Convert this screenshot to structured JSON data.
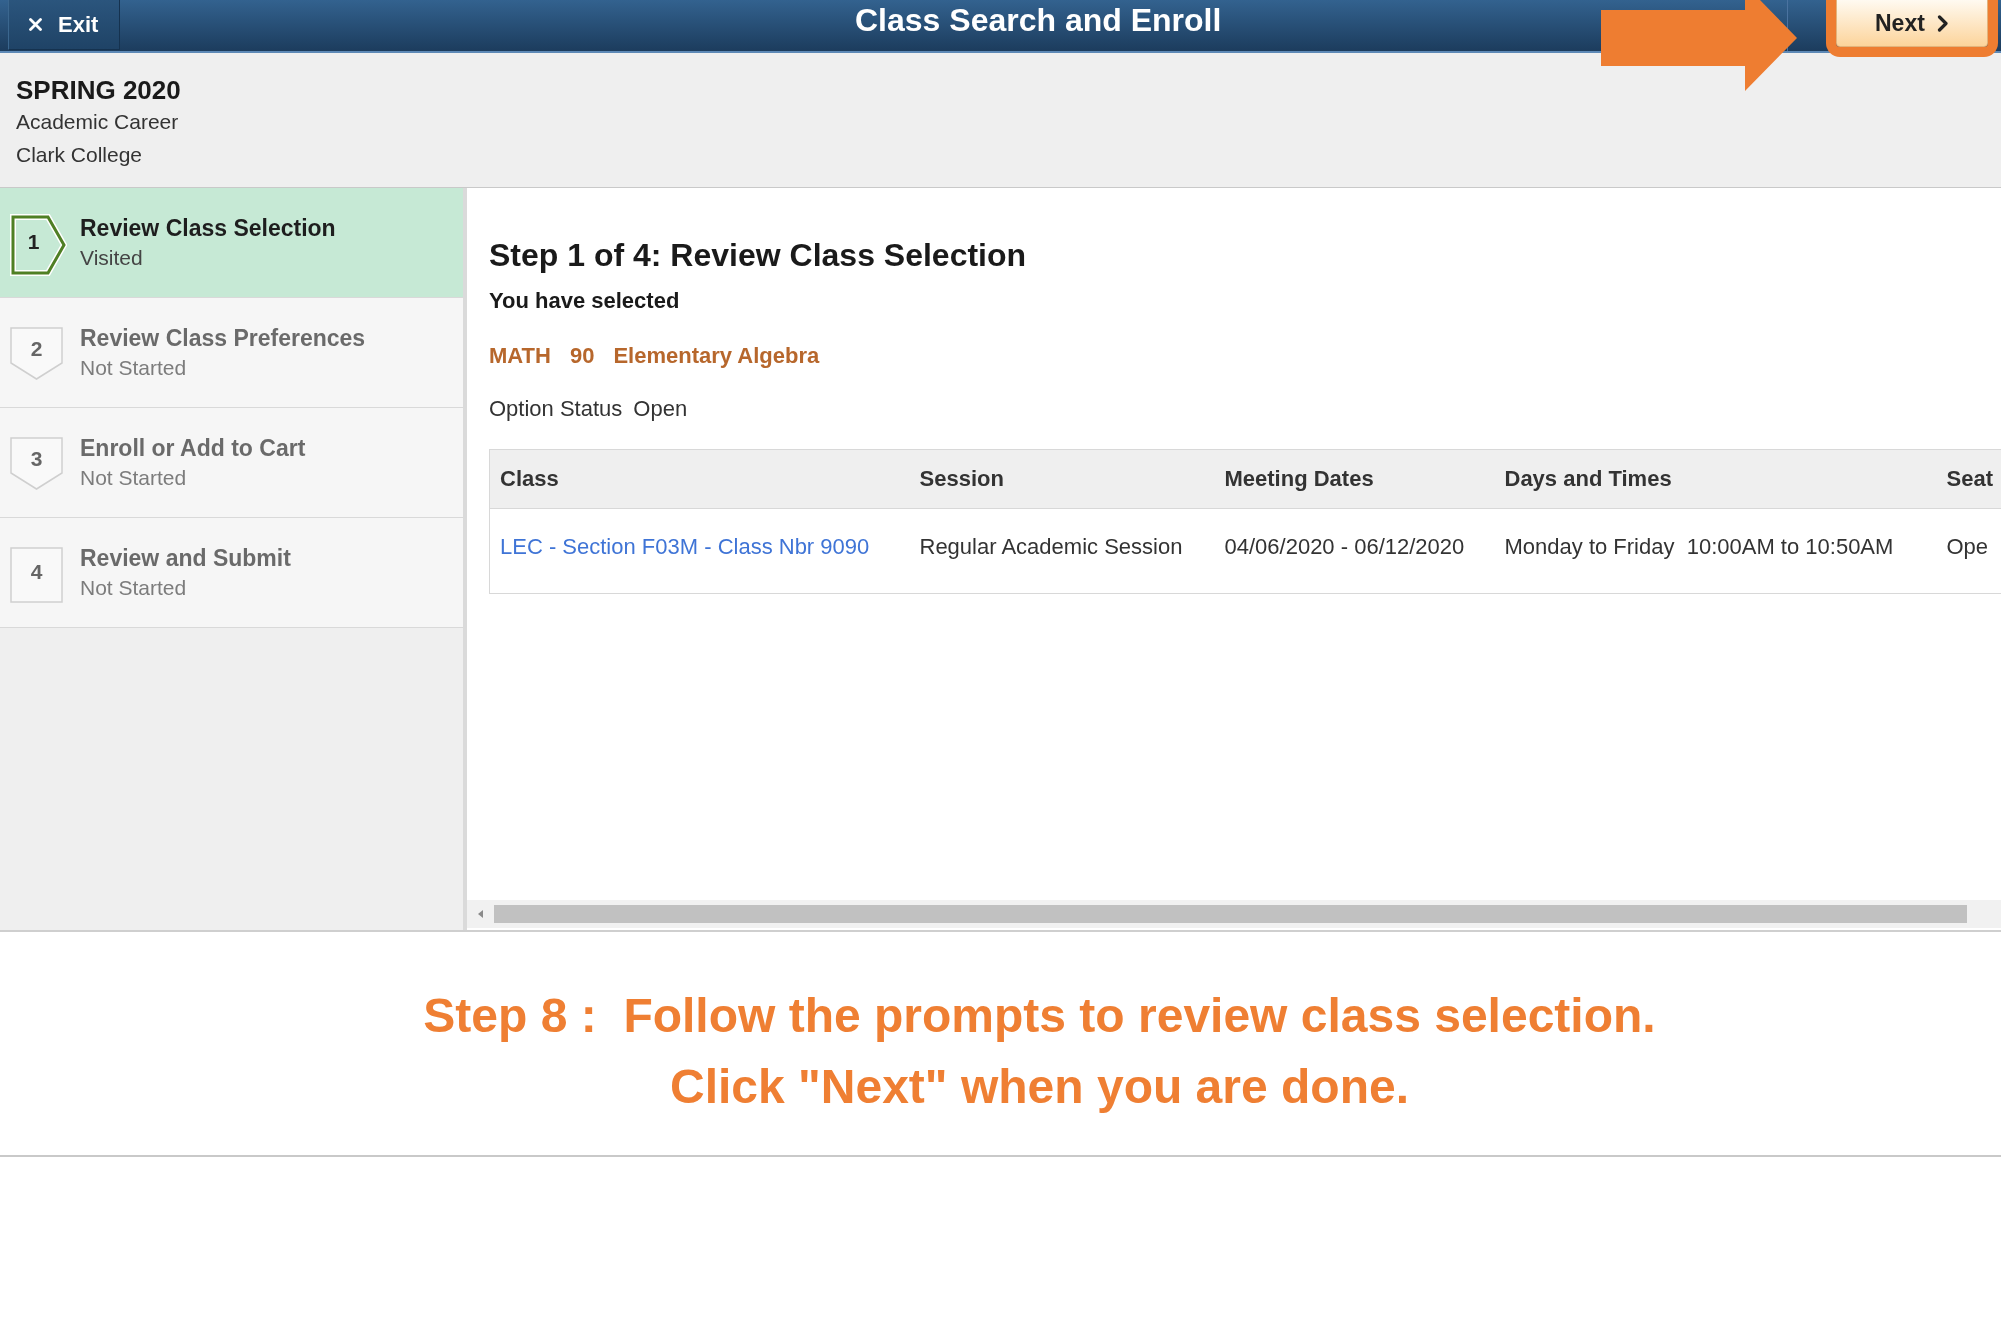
{
  "top_bar": {
    "exit_button": {
      "label": "Exit"
    },
    "title": "Class Search and Enroll",
    "next_button": {
      "label": "Next",
      "highlighted": true
    }
  },
  "term": {
    "name": "SPRING 2020",
    "career": "Academic Career",
    "institution": "Clark College"
  },
  "steps": [
    {
      "number": "1",
      "title": "Review Class Selection",
      "status": "Visited",
      "selected": true
    },
    {
      "number": "2",
      "title": "Review Class Preferences",
      "status": "Not Started",
      "selected": false
    },
    {
      "number": "3",
      "title": "Enroll or Add to Cart",
      "status": "Not Started",
      "selected": false
    },
    {
      "number": "4",
      "title": "Review and Submit",
      "status": "Not Started",
      "selected": false
    }
  ],
  "content": {
    "heading": "Step 1 of 4: Review Class Selection",
    "subheading": "You have selected",
    "course": {
      "subject": "MATH",
      "number": "90",
      "title": "Elementary Algebra"
    },
    "option_status": {
      "label": "Option Status",
      "value": "Open"
    },
    "table": {
      "columns": [
        "Class",
        "Session",
        "Meeting Dates",
        "Days and Times",
        "Seat"
      ],
      "rows": [
        {
          "cells": [
            {
              "text": "LEC - Section F03M - Class Nbr 9090",
              "kind": "link"
            },
            {
              "text": "Regular Academic Session",
              "kind": "text"
            },
            {
              "text": "04/06/2020 - 06/12/2020",
              "kind": "text"
            },
            {
              "text": "Monday to Friday  10:00AM to 10:50AM",
              "kind": "text"
            },
            {
              "text": "Ope",
              "kind": "text"
            }
          ]
        }
      ]
    }
  },
  "caption": {
    "lines": [
      "Step 8 :  Follow the prompts to review class selection.",
      "Click \"Next\" when you are done."
    ]
  }
}
